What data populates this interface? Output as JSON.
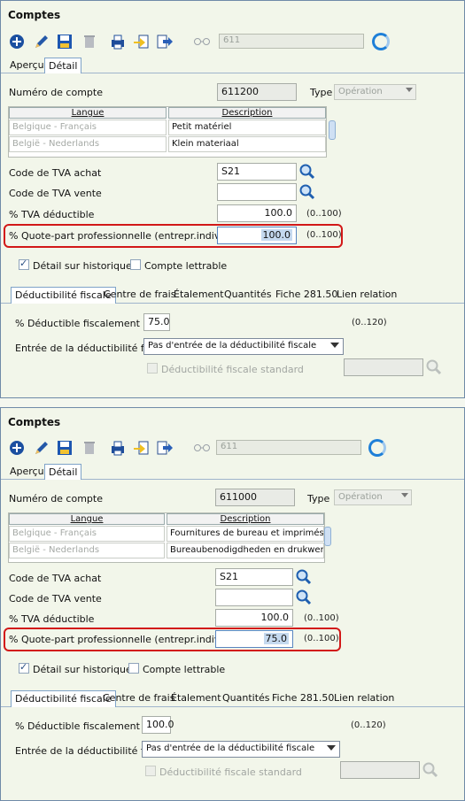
{
  "panels": [
    {
      "title": "Comptes",
      "record_field": "611",
      "tabs": [
        "Aperçu",
        "Détail"
      ],
      "account_label": "Numéro de compte",
      "account_value": "611200",
      "type_label": "Type",
      "type_value": "Opération",
      "grid_headers": [
        "Langue",
        "Description"
      ],
      "grid_rows": [
        {
          "lang": "Belgique - Français",
          "desc": "Petit matériel"
        },
        {
          "lang": "België - Nederlands",
          "desc": "Klein materiaal"
        }
      ],
      "vat_purchase_label": "Code de TVA achat",
      "vat_purchase_value": "S21",
      "vat_sale_label": "Code de TVA vente",
      "vat_sale_value": "",
      "vat_ded_label": "% TVA déductible",
      "vat_ded_value": "100.0",
      "vat_ded_range": "(0..100)",
      "quote_label": "% Quote-part professionnelle (entrepr.individuelle)",
      "quote_value": "100.0",
      "quote_range": "(0..100)",
      "hist_label": "Détail sur historique",
      "lettrable_label": "Compte lettrable",
      "sub_tabs": [
        "Déductibilité fiscale",
        "Centre de frais",
        "Étalement",
        "Quantités",
        "Fiche 281.50",
        "Lien relation"
      ],
      "fiscal_ded_label": "% Déductible fiscalement",
      "fiscal_ded_value": "75.0",
      "fiscal_ded_range": "(0..120)",
      "entry_label": "Entrée de la déductibilité fiscale",
      "entry_value": "Pas d'entrée de la déductibilité fiscale",
      "std_label": "Déductibilité fiscale standard"
    },
    {
      "title": "Comptes",
      "record_field": "611",
      "tabs": [
        "Aperçu",
        "Détail"
      ],
      "account_label": "Numéro de compte",
      "account_value": "611000",
      "type_label": "Type",
      "type_value": "Opération",
      "grid_headers": [
        "Langue",
        "Description"
      ],
      "grid_rows": [
        {
          "lang": "Belgique - Français",
          "desc": "Fournitures de bureau et imprimés"
        },
        {
          "lang": "België - Nederlands",
          "desc": "Bureaubenodigdheden en drukwerk"
        }
      ],
      "vat_purchase_label": "Code de TVA achat",
      "vat_purchase_value": "S21",
      "vat_sale_label": "Code de TVA vente",
      "vat_sale_value": "",
      "vat_ded_label": "% TVA déductible",
      "vat_ded_value": "100.0",
      "vat_ded_range": "(0..100)",
      "quote_label": "% Quote-part professionnelle (entrepr.individuelle)",
      "quote_value": "75.0",
      "quote_range": "(0..100)",
      "hist_label": "Détail sur historique",
      "lettrable_label": "Compte lettrable",
      "sub_tabs": [
        "Déductibilité fiscale",
        "Centre de frais",
        "Étalement",
        "Quantités",
        "Fiche 281.50",
        "Lien relation"
      ],
      "fiscal_ded_label": "% Déductible fiscalement",
      "fiscal_ded_value": "100.0",
      "fiscal_ded_range": "(0..120)",
      "entry_label": "Entrée de la déductibilité fiscale",
      "entry_value": "Pas d'entrée de la déductibilité fiscale",
      "std_label": "Déductibilité fiscale standard"
    }
  ],
  "toolbar_icons": [
    "add-icon",
    "edit-pencil-icon",
    "save-disk-icon",
    "delete-trash-icon",
    "print-icon",
    "import-icon",
    "export-icon",
    "link-glasses-icon",
    "refresh-spinner-icon"
  ],
  "colors": {
    "highlight": "#d21818",
    "accent": "#1e7fd8",
    "panel_bg": "#f2f6ea"
  }
}
